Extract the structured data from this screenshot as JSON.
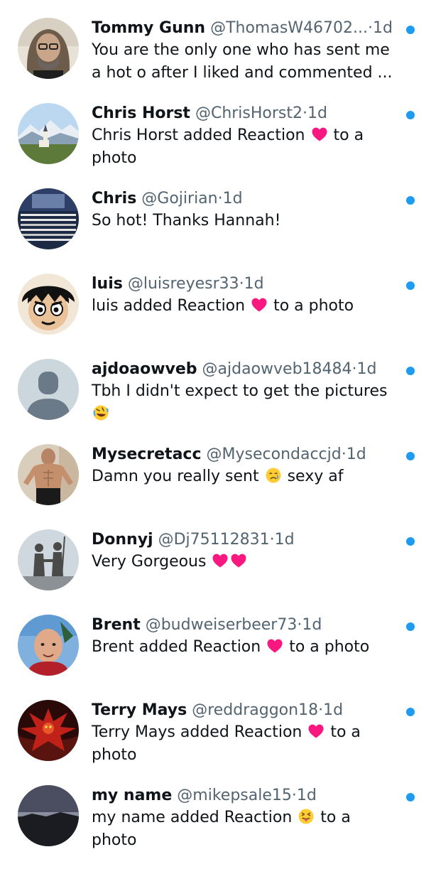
{
  "colors": {
    "unread_dot": "#1d9bf0",
    "handle_text": "#536471",
    "heart": "#f91880"
  },
  "separator": "·",
  "notifications": [
    {
      "name": "Tommy Gunn",
      "handle": "@ThomasW46702...",
      "time": "1d",
      "avatar_icon": "long-haired-bearded-man-avatar",
      "message": [
        {
          "text": "You are the only one who has sent me"
        },
        {
          "text": "a hot o after I liked and commented ..."
        }
      ]
    },
    {
      "name": "Chris Horst",
      "handle": "@ChrisHorst2",
      "time": "1d",
      "avatar_icon": "church-mountain-landscape-avatar",
      "message": [
        {
          "text": "Chris Horst added Reaction "
        },
        {
          "emoji": "red-heart-emoji"
        },
        {
          "text": " to a"
        },
        {
          "text": "photo",
          "break_before": true
        }
      ]
    },
    {
      "name": "Chris",
      "handle": "@Gojirian",
      "time": "1d",
      "avatar_icon": "movie-poster-text-avatar",
      "message": [
        {
          "text": "So hot! Thanks Hannah!"
        }
      ]
    },
    {
      "name": "luis",
      "handle": "@luisreyesr33",
      "time": "1d",
      "avatar_icon": "anime-character-avatar",
      "message": [
        {
          "text": "luis added Reaction "
        },
        {
          "emoji": "red-heart-emoji"
        },
        {
          "text": " to a photo"
        }
      ]
    },
    {
      "name": "ajdoaowveb",
      "handle": "@ajdaowveb18484",
      "time": "1d",
      "avatar_icon": "default-person-avatar",
      "message": [
        {
          "text": "Tbh I didn't expect to get the pictures"
        },
        {
          "emoji": "rolling-laughing-emoji",
          "break_before": true
        }
      ]
    },
    {
      "name": "Mysecretacc",
      "handle": "@Mysecondaccjd",
      "time": "1d",
      "avatar_icon": "shirtless-man-avatar",
      "message": [
        {
          "text": "Damn you really sent "
        },
        {
          "emoji": "weary-face-emoji"
        },
        {
          "text": " sexy af"
        }
      ]
    },
    {
      "name": "Donnyj",
      "handle": "@Dj75112831",
      "time": "1d",
      "avatar_icon": "statue-figures-avatar",
      "message": [
        {
          "text": "Very Gorgeous "
        },
        {
          "emoji": "red-heart-emoji"
        },
        {
          "emoji": "red-heart-emoji"
        }
      ]
    },
    {
      "name": "Brent",
      "handle": "@budweiserbeer73",
      "time": "1d",
      "avatar_icon": "bald-man-selfie-avatar",
      "message": [
        {
          "text": "Brent added Reaction "
        },
        {
          "emoji": "red-heart-emoji"
        },
        {
          "text": " to a photo"
        }
      ]
    },
    {
      "name": "Terry Mays",
      "handle": "@reddraggon18",
      "time": "1d",
      "avatar_icon": "red-dragon-avatar",
      "message": [
        {
          "text": "Terry Mays added Reaction "
        },
        {
          "emoji": "red-heart-emoji"
        },
        {
          "text": " to a"
        },
        {
          "text": "photo",
          "break_before": true
        }
      ]
    },
    {
      "name": "my name",
      "handle": "@mikepsale15",
      "time": "1d",
      "avatar_icon": "dusk-landscape-avatar",
      "message": [
        {
          "text": "my name added Reaction "
        },
        {
          "emoji": "tongue-out-face-emoji"
        },
        {
          "text": " to a"
        },
        {
          "text": "photo",
          "break_before": true
        }
      ]
    }
  ]
}
